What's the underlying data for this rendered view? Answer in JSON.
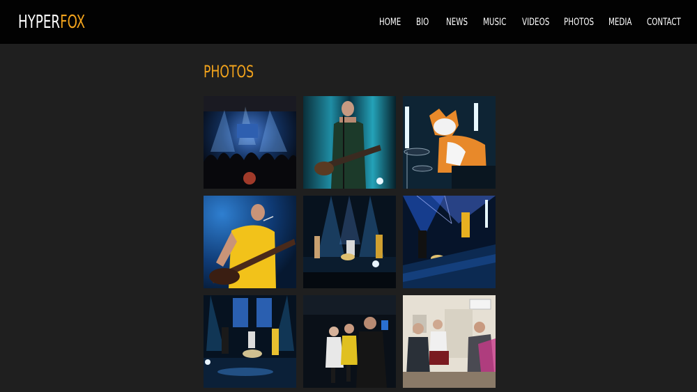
{
  "brand": {
    "part1": "HYPER",
    "part2": "FOX",
    "accent_color": "#f2a31c"
  },
  "nav": {
    "items": [
      {
        "label": "HOME"
      },
      {
        "label": "BIO"
      },
      {
        "label": "NEWS"
      },
      {
        "label": "MUSIC"
      },
      {
        "label": "VIDEOS"
      },
      {
        "label": "PHOTOS"
      },
      {
        "label": "MEDIA"
      },
      {
        "label": "CONTACT"
      }
    ]
  },
  "page": {
    "title": "PHOTOS"
  },
  "gallery": {
    "photos": [
      {
        "subject": "concert crowd with stage lights"
      },
      {
        "subject": "singer with guitar at microphone"
      },
      {
        "subject": "drummer in fox costume"
      },
      {
        "subject": "bassist in yellow shirt"
      },
      {
        "subject": "band on blue lit stage"
      },
      {
        "subject": "band on stage with laser lights"
      },
      {
        "subject": "band on stage with drum kit"
      },
      {
        "subject": "people gathering backstage"
      },
      {
        "subject": "group in a room"
      }
    ]
  }
}
